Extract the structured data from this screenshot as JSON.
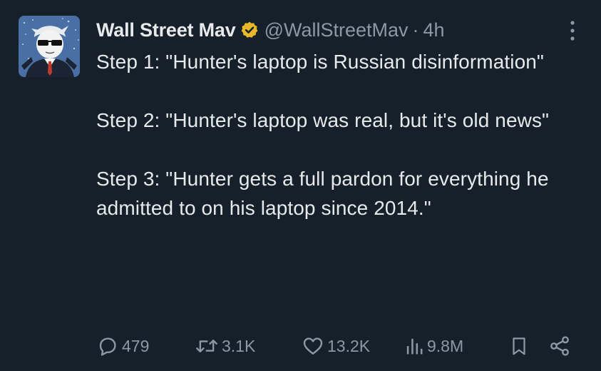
{
  "tweet": {
    "display_name": "Wall Street Mav",
    "handle": "@WallStreetMav",
    "separator": "·",
    "time": "4h",
    "paragraphs": [
      "Step 1: \"Hunter's laptop is Russian disinformation\"",
      "Step 2: \"Hunter's laptop was real, but it's old news\"",
      "Step 3: \"Hunter gets a full pardon for everything he admitted to on his laptop since 2014.\""
    ]
  },
  "metrics": {
    "replies": "479",
    "reposts": "3.1K",
    "likes": "13.2K",
    "views": "9.8M"
  },
  "icons": {
    "verified": "verified-gold-badge-icon",
    "more": "more-vertical-icon",
    "reply": "reply-icon",
    "repost": "repost-icon",
    "like": "heart-icon",
    "views": "views-chart-icon",
    "bookmark": "bookmark-icon",
    "share": "share-icon"
  },
  "colors": {
    "background": "#15202b",
    "text": "#e7e9ea",
    "secondary": "#8b98a5",
    "verified": "#e8b829"
  }
}
